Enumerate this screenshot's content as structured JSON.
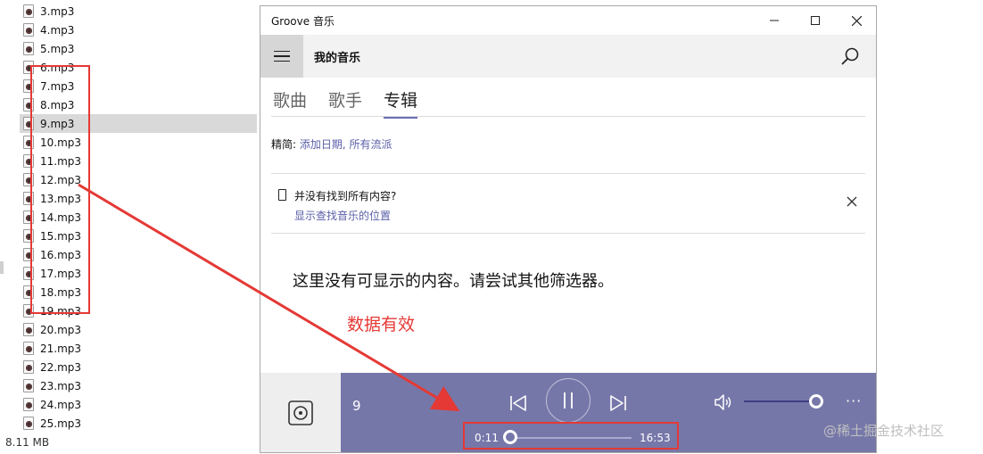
{
  "explorer": {
    "files": [
      "3.mp3",
      "4.mp3",
      "5.mp3",
      "6.mp3",
      "7.mp3",
      "8.mp3",
      "9.mp3",
      "10.mp3",
      "11.mp3",
      "12.mp3",
      "13.mp3",
      "14.mp3",
      "15.mp3",
      "16.mp3",
      "17.mp3",
      "18.mp3",
      "19.mp3",
      "20.mp3",
      "21.mp3",
      "22.mp3",
      "23.mp3",
      "24.mp3",
      "25.mp3"
    ],
    "selected_file": "9.mp3",
    "status_size": "8.11 MB"
  },
  "annotation": {
    "text": "数据有效",
    "color": "#e53935"
  },
  "groove": {
    "app_title": "Groove 音乐",
    "page_title": "我的音乐",
    "tabs": [
      {
        "label": "歌曲",
        "active": false
      },
      {
        "label": "歌手",
        "active": false
      },
      {
        "label": "专辑",
        "active": true
      }
    ],
    "filter_label": "精简: ",
    "filter_value": "添加日期, 所有流派",
    "notice_title": "并没有找到所有内容?",
    "notice_link": "显示查找音乐的位置",
    "empty_message": "这里没有可显示的内容。请尝试其他筛选器。",
    "accent_color": "#6b6fb6",
    "player": {
      "track_title": "9",
      "time_current": "0:11",
      "time_total": "16:53",
      "progress_fraction": 0.011,
      "volume_fraction": 0.92,
      "more_label": "···",
      "bar_color": "#7677a9"
    }
  },
  "watermark": "@稀土掘金技术社区",
  "icons": {
    "hamburger": "hamburger-menu-icon",
    "search": "search-icon",
    "notice": "phone-icon",
    "close": "close-icon",
    "album": "album-placeholder-icon",
    "prev": "skip-previous-icon",
    "pause": "pause-icon",
    "next": "skip-next-icon",
    "volume": "volume-icon"
  }
}
